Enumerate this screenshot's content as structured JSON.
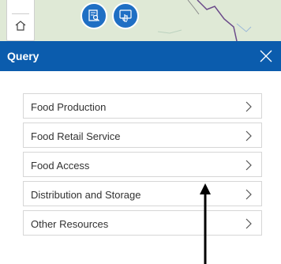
{
  "map": {
    "zoom_home_icon": "home-icon",
    "buttons": [
      {
        "icon": "search-layer-icon"
      },
      {
        "icon": "select-hand-icon"
      }
    ]
  },
  "panel": {
    "title": "Query",
    "close_icon": "close-icon"
  },
  "items": [
    {
      "label": "Food Production"
    },
    {
      "label": "Food Retail Service"
    },
    {
      "label": "Food Access"
    },
    {
      "label": "Distribution and Storage"
    },
    {
      "label": "Other Resources"
    }
  ],
  "colors": {
    "header": "#0b5cad",
    "map_button": "#1f6fc4"
  }
}
